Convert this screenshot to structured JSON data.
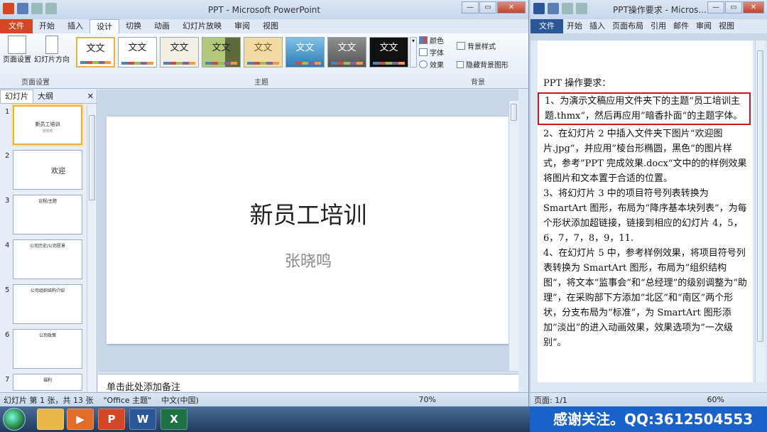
{
  "ppt": {
    "title": "PPT - Microsoft PowerPoint",
    "tabs": [
      "文件",
      "开始",
      "插入",
      "设计",
      "切换",
      "动画",
      "幻灯片放映",
      "审阅",
      "视图"
    ],
    "active_tab": 3,
    "page_setup": {
      "btn1": "页面设置",
      "btn2": "幻灯片方向",
      "group": "页面设置"
    },
    "themes": {
      "sample": "文文",
      "group": "主题",
      "colors": "颜色",
      "fonts": "字体",
      "effects": "效果"
    },
    "background": {
      "style": "背景样式",
      "hide": "隐藏背景图形",
      "group": "背景"
    },
    "pane_tabs": [
      "幻灯片",
      "大纲"
    ],
    "thumbnails": [
      {
        "num": "1",
        "title": "新员工培训",
        "sub": "张晓鸣"
      },
      {
        "num": "2",
        "title": "欢迎"
      },
      {
        "num": "3",
        "title": "议程/主题"
      },
      {
        "num": "4",
        "title": "公司历史/公司愿景"
      },
      {
        "num": "5",
        "title": "公司组织结构介绍"
      },
      {
        "num": "6",
        "title": "公司政策"
      },
      {
        "num": "7",
        "title": "福利"
      }
    ],
    "slide": {
      "title": "新员工培训",
      "subtitle": "张晓鸣"
    },
    "notes_placeholder": "单击此处添加备注",
    "status": {
      "slide": "幻灯片 第 1 张，共 13 张",
      "theme": "\"Office 主题\"",
      "lang": "中文(中国)",
      "zoom": "70%"
    }
  },
  "word": {
    "title": "PPT操作要求 - Micros...",
    "tabs": [
      "文件",
      "开始",
      "插入",
      "页面布局",
      "引用",
      "邮件",
      "审阅",
      "视图"
    ],
    "heading": "PPT 操作要求：",
    "items": [
      "1、为演示文稿应用文件夹下的主题“员工培训主题.thmx“，然后再应用”暗香扑面“的主题字体。",
      "2、在幻灯片 2 中插入文件夹下图片“欢迎图片.jpg“，并应用”棱台形椭圆，黑色“的图片样式，参考”PPT 完成效果.docx“文中的的样例效果将图片和文本置于合适的位置。",
      "3、将幻灯片 3 中的项目符号列表转换为 SmartArt 图形，布局为“降序基本块列表“，为每个形状添加超链接，链接到相应的幻灯片 4，5，6，7，7，8，9，11.",
      "4、在幻灯片 5 中，参考样例效果，将项目符号列表转换为 SmartArt 图形，布局为”组织结构图“，将文本“监事会”和“总经理”的级别调整为“助理”，在采购部下方添加“北区”和“南区”两个形状，分支布局为“标准”，为 SmartArt 图形添加“淡出”的进入动画效果，效果选项为“一次级别”。"
    ],
    "status": {
      "page": "页面: 1/1",
      "zoom": "60%"
    }
  },
  "banner": "感谢关注。QQ:3612504553"
}
